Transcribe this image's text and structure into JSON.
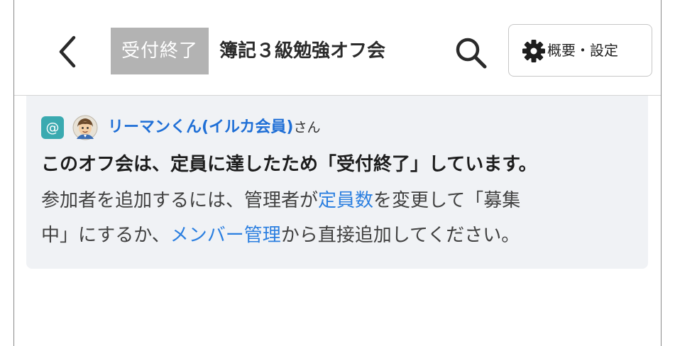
{
  "header": {
    "back_icon": "chevron-left-icon",
    "status": "受付終了",
    "title": "簿記３級勉強オフ会",
    "search_icon": "search-icon",
    "settings_icon": "gear-icon",
    "settings_label": "概要・設定"
  },
  "notice": {
    "mention_symbol": "@",
    "user_name": "リーマンくん(イルカ会員)",
    "user_suffix": "さん",
    "title": "このオフ会は、定員に達したため「受付終了」しています。",
    "line1_part1": "参加者を追加するには、管理者が",
    "line1_link": "定員数",
    "line1_part2": "を変更して「募集",
    "line2_part1": "中」にするか、",
    "line2_link": "メンバー管理",
    "line2_part2": "から直接追加してください。"
  },
  "colors": {
    "link": "#2b7fe0",
    "status_chip": "#b3b3b3",
    "mention_badge": "#3aaab0",
    "notice_bg": "#f0f2f5"
  }
}
